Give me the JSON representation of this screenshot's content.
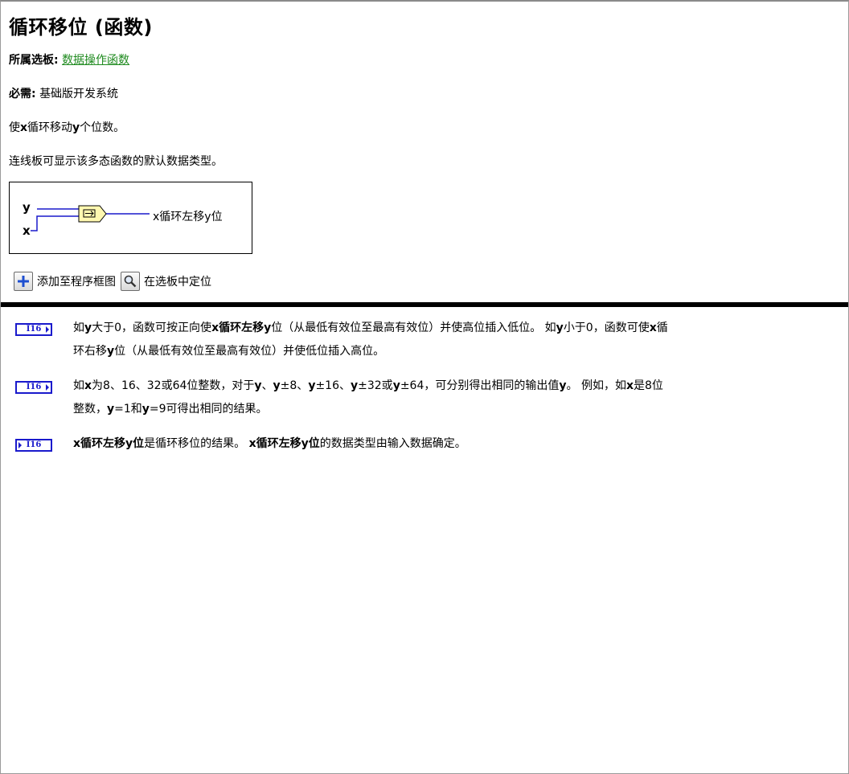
{
  "page": {
    "title": "循环移位 (函数)"
  },
  "meta": {
    "palette_label": "所属选板:",
    "palette_link": "数据操作函数",
    "requires_label": "必需:",
    "requires_value": "基础版开发系统"
  },
  "description": {
    "p1_a": "使",
    "p1_x": "x",
    "p1_b": "循环移动",
    "p1_y": "y",
    "p1_c": "个位数。",
    "p2": "连线板可显示该多态函数的默认数据类型。"
  },
  "connector": {
    "input_y": "y",
    "input_x": "x",
    "output": "x循环左移y位"
  },
  "actions": {
    "add_label": "添加至程序框图",
    "locate_label": "在选板中定位"
  },
  "terminals": [
    {
      "icon_text": "I16",
      "kind": "control",
      "line1": [
        {
          "t": "如",
          "b": false
        },
        {
          "t": "y",
          "b": true
        },
        {
          "t": "大于0，函数可按正向使",
          "b": false
        },
        {
          "t": "x循环左移y",
          "b": true
        },
        {
          "t": "位（从最低有效位至最高有效位）并使高位插入低位。 如",
          "b": false
        },
        {
          "t": "y",
          "b": true
        },
        {
          "t": "小于0，函数可使",
          "b": false
        },
        {
          "t": "x",
          "b": true
        },
        {
          "t": "循",
          "b": false
        }
      ],
      "line2": [
        {
          "t": "环右移",
          "b": false
        },
        {
          "t": "y",
          "b": true
        },
        {
          "t": "位（从最低有效位至最高有效位）并使低位插入高位。",
          "b": false
        }
      ]
    },
    {
      "icon_text": "I16",
      "kind": "control",
      "line1": [
        {
          "t": "如",
          "b": false
        },
        {
          "t": "x",
          "b": true
        },
        {
          "t": "为8、16、32或64位整数，对于",
          "b": false
        },
        {
          "t": "y",
          "b": true
        },
        {
          "t": "、",
          "b": false
        },
        {
          "t": "y",
          "b": true
        },
        {
          "t": "±8、",
          "b": false
        },
        {
          "t": "y",
          "b": true
        },
        {
          "t": "±16、",
          "b": false
        },
        {
          "t": "y",
          "b": true
        },
        {
          "t": "±32或",
          "b": false
        },
        {
          "t": "y",
          "b": true
        },
        {
          "t": "±64，可分别得出相同的输出值",
          "b": false
        },
        {
          "t": "y",
          "b": true
        },
        {
          "t": "。 例如，如",
          "b": false
        },
        {
          "t": "x",
          "b": true
        },
        {
          "t": "是8位",
          "b": false
        }
      ],
      "line2": [
        {
          "t": "整数，",
          "b": false
        },
        {
          "t": "y",
          "b": true
        },
        {
          "t": "=1和",
          "b": false
        },
        {
          "t": "y",
          "b": true
        },
        {
          "t": "=9可得出相同的结果。",
          "b": false
        }
      ]
    },
    {
      "icon_text": "I16",
      "kind": "indicator",
      "line1": [
        {
          "t": "x循环左移y位",
          "b": true
        },
        {
          "t": "是循环移位的结果。 ",
          "b": false
        },
        {
          "t": "x循环左移y位",
          "b": true
        },
        {
          "t": "的数据类型由输入数据确定。",
          "b": false
        }
      ],
      "line2": []
    }
  ]
}
